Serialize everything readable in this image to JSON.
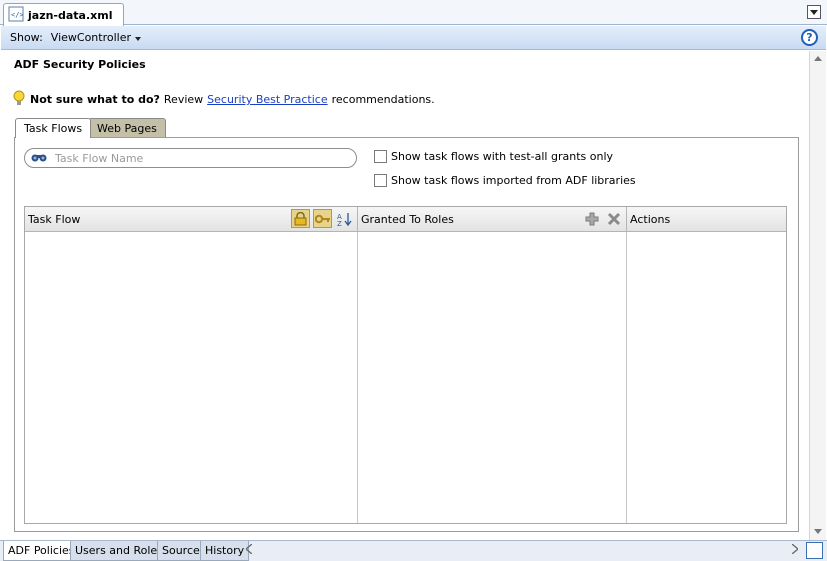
{
  "editor": {
    "file_tab_label": "jazn-data.xml"
  },
  "showbar": {
    "show_label": "Show:",
    "project": "ViewController",
    "help_glyph": "?"
  },
  "page": {
    "title": "ADF Security Policies",
    "hint_strong": "Not sure what to do?",
    "hint_prefix": "Review",
    "hint_link": "Security Best Practice",
    "hint_suffix": "recommendations."
  },
  "inner_tabs": [
    {
      "label": "Task Flows",
      "active": true
    },
    {
      "label": "Web Pages",
      "active": false
    }
  ],
  "search": {
    "placeholder": "Task Flow Name",
    "value": ""
  },
  "filters": {
    "test_all": {
      "label": "Show task flows with test-all grants only",
      "checked": false
    },
    "imported": {
      "label": "Show task flows imported from ADF libraries",
      "checked": false
    }
  },
  "table": {
    "columns": [
      "Task Flow",
      "Granted To Roles",
      "Actions"
    ],
    "rows": []
  },
  "bottom_tabs": [
    {
      "label": "ADF Policies",
      "active": true
    },
    {
      "label": "Users and Roles",
      "active": false
    },
    {
      "label": "Source",
      "active": false
    },
    {
      "label": "History",
      "active": false
    }
  ],
  "icons": {
    "file": "xml-file-icon",
    "dropdown": "chevron-down-icon",
    "help": "help-icon",
    "hint": "lightbulb-icon",
    "search": "binoculars-icon",
    "lock": "lock-icon",
    "key": "key-icon",
    "sort": "sort-az-icon",
    "add": "add-icon",
    "delete": "delete-icon"
  },
  "colors": {
    "link": "#1a3fc4",
    "accent": "#1f5fb8",
    "inactive_tab": "#c4c0a8"
  }
}
